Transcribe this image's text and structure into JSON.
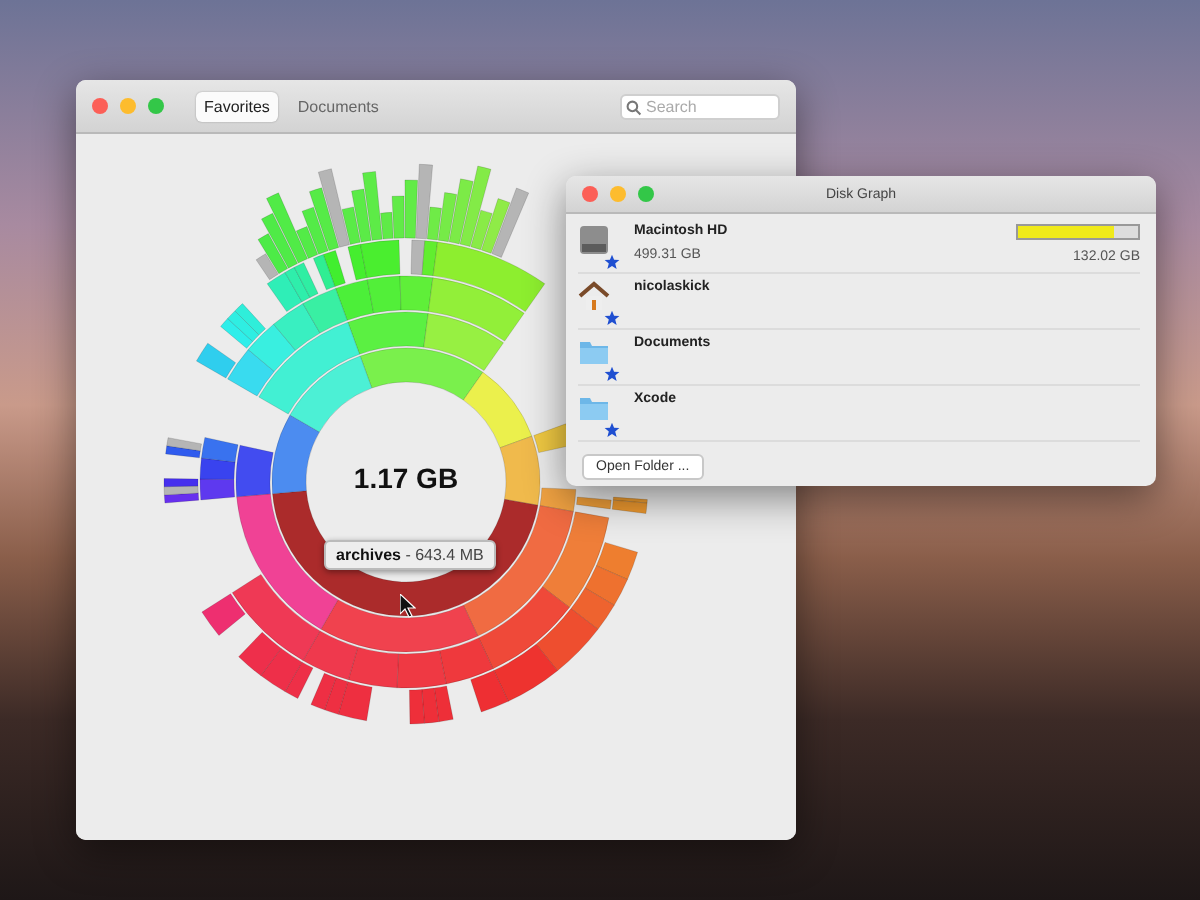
{
  "main_window": {
    "tabs": [
      {
        "label": "Favorites",
        "selected": true
      },
      {
        "label": "Documents",
        "selected": false
      }
    ],
    "search": {
      "placeholder": "Search"
    },
    "center_label": "1.17 GB",
    "tooltip": "**archives** - 643.4 MB"
  },
  "disk_window": {
    "title": "Disk Graph",
    "items": [
      {
        "kind": "disk",
        "name": "Macintosh HD",
        "favorite": true,
        "size": "499.31 GB",
        "free": "132.02 GB",
        "level": 0.8
      },
      {
        "kind": "home",
        "name": "nicolaskick",
        "favorite": true
      },
      {
        "kind": "folder",
        "name": "Documents",
        "favorite": true
      },
      {
        "kind": "folder",
        "name": "Xcode",
        "favorite": true
      }
    ],
    "button": "Open Folder ..."
  }
}
